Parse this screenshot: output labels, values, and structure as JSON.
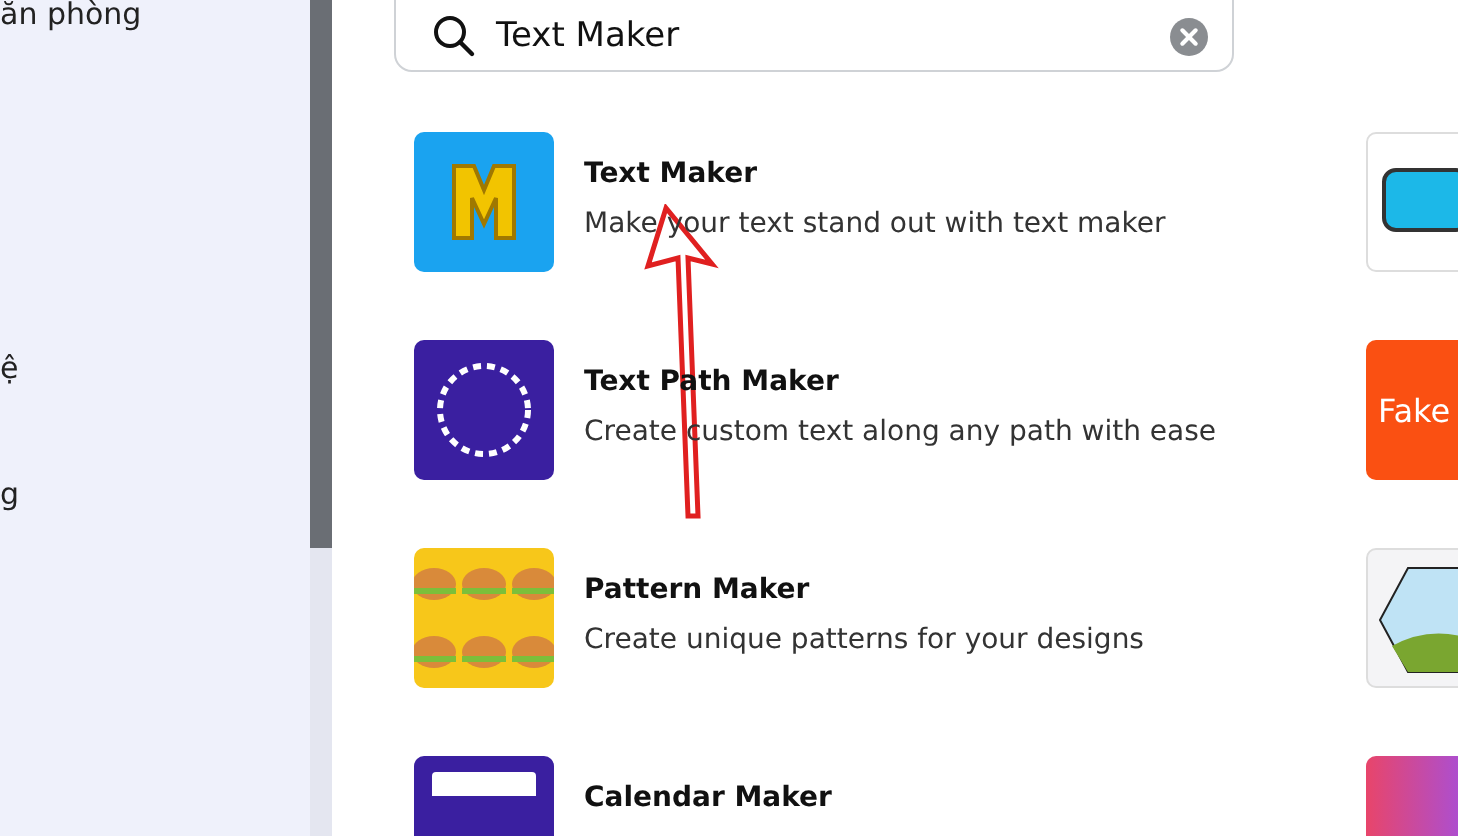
{
  "sidebar": {
    "items": [
      {
        "label": "ăn phòng"
      },
      {
        "label": "ệ"
      },
      {
        "label": "g"
      }
    ]
  },
  "search": {
    "value": "Text Maker"
  },
  "results": [
    {
      "kind": "text",
      "title": "Text Maker",
      "description": "Make your text stand out with text maker"
    },
    {
      "kind": "path",
      "title": "Text Path Maker",
      "description": "Create custom text along any path with ease"
    },
    {
      "kind": "pattern",
      "title": "Pattern Maker",
      "description": "Create unique patterns for your designs"
    },
    {
      "kind": "calendar",
      "title": "Calendar Maker"
    }
  ],
  "side_results": [
    {
      "kind": "letters"
    },
    {
      "kind": "fake",
      "label": "Fake"
    },
    {
      "kind": "shape"
    },
    {
      "kind": "gradient"
    }
  ]
}
